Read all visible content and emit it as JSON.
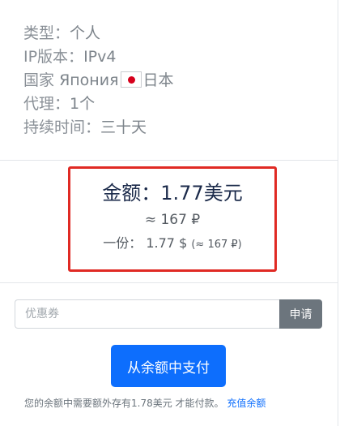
{
  "details": {
    "type": {
      "label": "类型：",
      "value": "个人"
    },
    "ip_version": {
      "label": "IP版本：",
      "value": "IPv4"
    },
    "country": {
      "label": "国家",
      "value_ru": "Япония",
      "value_zh": "日本",
      "flag_icon": "japan-flag-icon"
    },
    "proxy": {
      "label": "代理：",
      "value": "1个"
    },
    "duration": {
      "label": "持续时间：",
      "value": "三十天"
    }
  },
  "price": {
    "amount_label": "金额：",
    "amount_value": "1.77美元",
    "rub_approx": "≈ 167 ₽",
    "portion_label": "一份：",
    "portion_value": "1.77 $",
    "portion_rub": "(≈ 167 ₽)",
    "highlight_color": "#e02a24"
  },
  "coupon": {
    "placeholder": "优惠券",
    "apply_label": "申请"
  },
  "pay_button_label": "从余额中支付",
  "notice": {
    "text": "您的余额中需要额外存有1.78美元 才能付款。",
    "topup_link": "充值余额"
  },
  "colors": {
    "primary": "#0d6efd",
    "secondary": "#6c757d"
  }
}
